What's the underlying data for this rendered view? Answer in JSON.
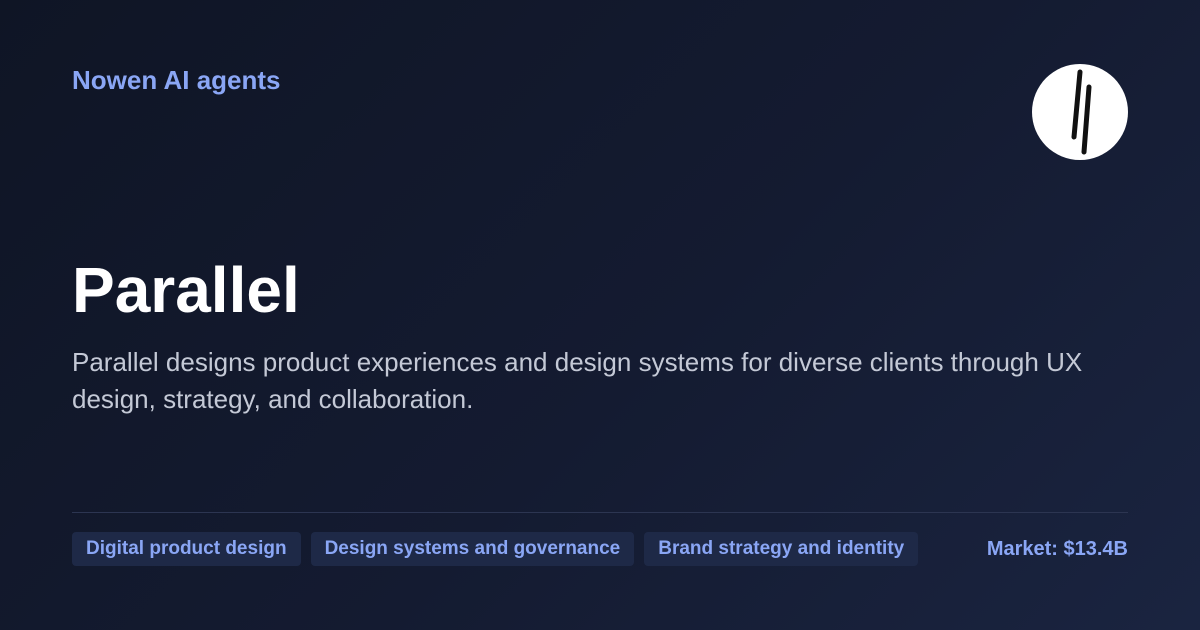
{
  "header": {
    "brand": "Nowen AI agents",
    "logo_icon": "parallel-lines-icon"
  },
  "main": {
    "title": "Parallel",
    "description": "Parallel designs product experiences and design systems for diverse clients through UX design, strategy, and collaboration."
  },
  "footer": {
    "tags": [
      {
        "label": "Digital product design"
      },
      {
        "label": "Design systems and governance"
      },
      {
        "label": "Brand strategy and identity"
      }
    ],
    "market": "Market: $13.4B"
  },
  "colors": {
    "background": "#141b31",
    "accent": "#8aa6f5",
    "title": "#ffffff",
    "description": "#c4c9d6",
    "tag_background": "#1e2947"
  }
}
